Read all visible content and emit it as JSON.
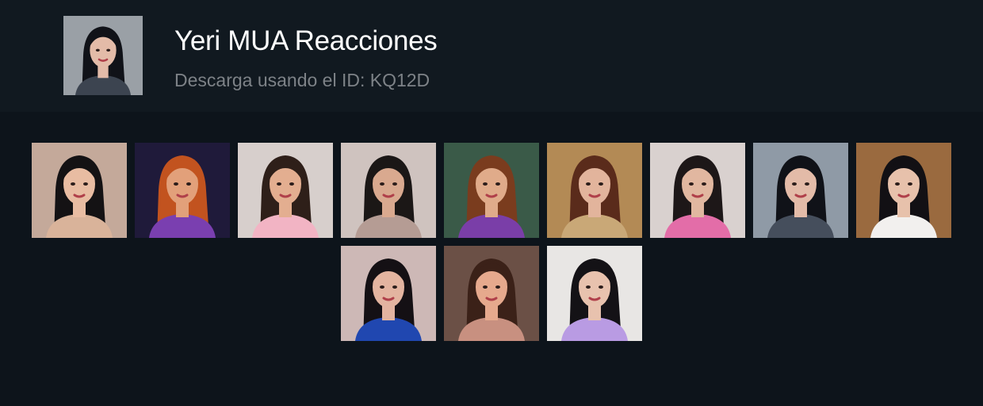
{
  "header": {
    "title": "Yeri MUA Reacciones",
    "subtitle": "Descarga usando el ID: KQ12D"
  },
  "stickers": [
    {
      "bg": "#c4a99a",
      "hair": "#141214",
      "skin": "#e8bca2",
      "top": "#d9b39a"
    },
    {
      "bg": "#1f1a3a",
      "hair": "#c2531f",
      "skin": "#e2a07a",
      "top": "#7a3fb0"
    },
    {
      "bg": "#d7cfcc",
      "hair": "#2e1f19",
      "skin": "#e3ae90",
      "top": "#f2b4c4"
    },
    {
      "bg": "#cfc3bf",
      "hair": "#1b1716",
      "skin": "#d9a98f",
      "top": "#b59c94"
    },
    {
      "bg": "#3a5a48",
      "hair": "#7a3c1e",
      "skin": "#e0ab8a",
      "top": "#7a3ea8"
    },
    {
      "bg": "#b38a55",
      "hair": "#5a2b1b",
      "skin": "#e2b49c",
      "top": "#c9a877"
    },
    {
      "bg": "#d9d1cf",
      "hair": "#1d1718",
      "skin": "#e1b7a0",
      "top": "#e36da8"
    },
    {
      "bg": "#8f9aa6",
      "hair": "#101218",
      "skin": "#e3bba8",
      "top": "#454e5c"
    },
    {
      "bg": "#9a6a3f",
      "hair": "#121014",
      "skin": "#e7c1ab",
      "top": "#f2f0ee"
    },
    {
      "bg": "#cdb8b6",
      "hair": "#141014",
      "skin": "#e3b4a0",
      "top": "#2047b0"
    },
    {
      "bg": "#6b5046",
      "hair": "#3b2118",
      "skin": "#e6a98d",
      "top": "#c89080"
    },
    {
      "bg": "#e8e6e4",
      "hair": "#141216",
      "skin": "#e8c2ae",
      "top": "#b99be3"
    }
  ],
  "avatar": {
    "bg": "#9aa0a6",
    "hair": "#101218",
    "skin": "#e3bba8",
    "top": "#3c4450"
  }
}
